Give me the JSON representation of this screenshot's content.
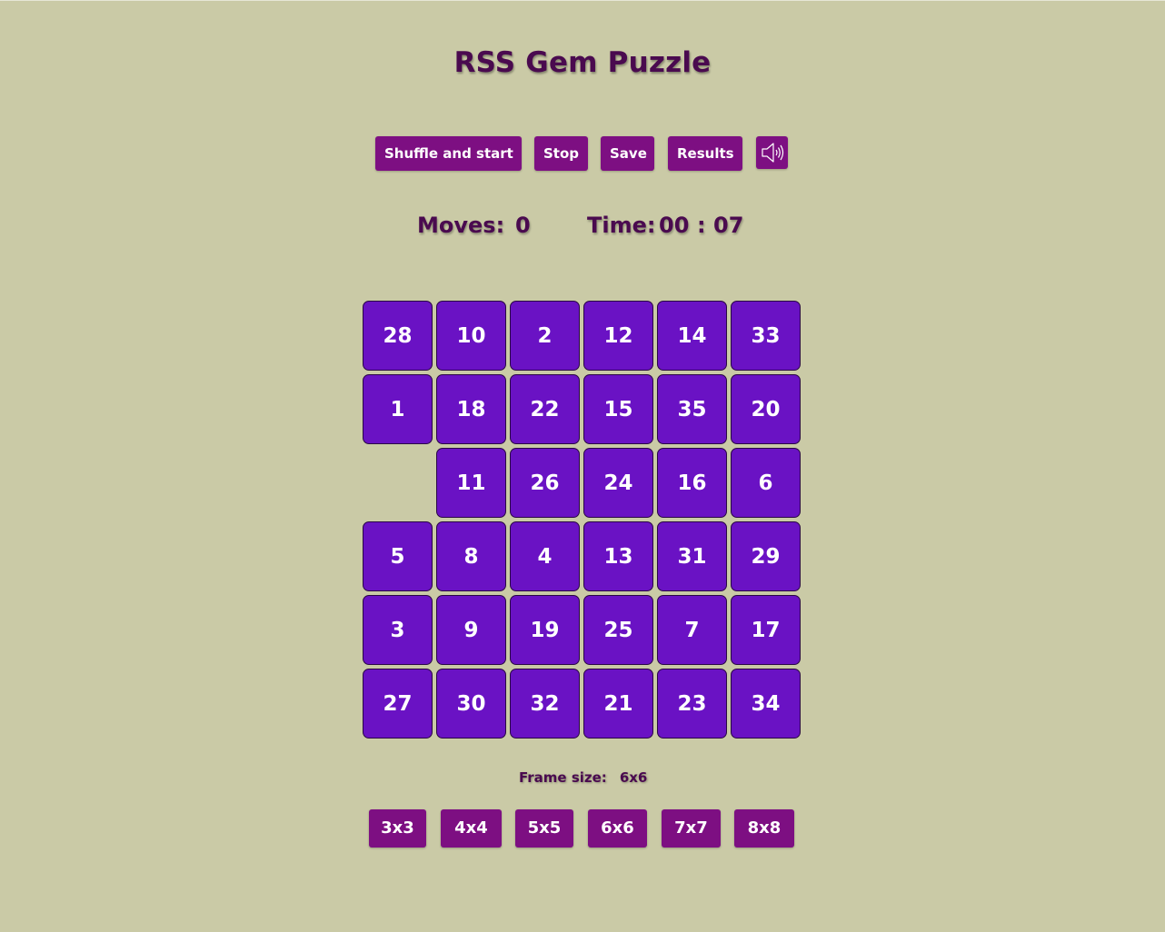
{
  "title": "RSS Gem Puzzle",
  "toolbar": {
    "shuffle_label": "Shuffle and start",
    "stop_label": "Stop",
    "save_label": "Save",
    "results_label": "Results",
    "sound_icon": "speaker-icon"
  },
  "stats": {
    "moves_label": "Moves:",
    "moves_value": "0",
    "time_label": "Time:",
    "time_minutes": "00",
    "time_separator": ":",
    "time_seconds": "07"
  },
  "board": {
    "size": 6,
    "tiles": [
      28,
      10,
      2,
      12,
      14,
      33,
      1,
      18,
      22,
      15,
      35,
      20,
      null,
      11,
      26,
      24,
      16,
      6,
      5,
      8,
      4,
      13,
      31,
      29,
      3,
      9,
      19,
      25,
      7,
      17,
      27,
      30,
      32,
      21,
      23,
      34
    ]
  },
  "frame": {
    "label": "Frame size:",
    "value": "6x6"
  },
  "size_options": [
    "3x3",
    "4x4",
    "5x5",
    "6x6",
    "7x7",
    "8x8"
  ],
  "colors": {
    "background": "#cacaa6",
    "button": "#7d0f82",
    "tile": "#6a12c4",
    "text_dark": "#4a0a4f"
  }
}
